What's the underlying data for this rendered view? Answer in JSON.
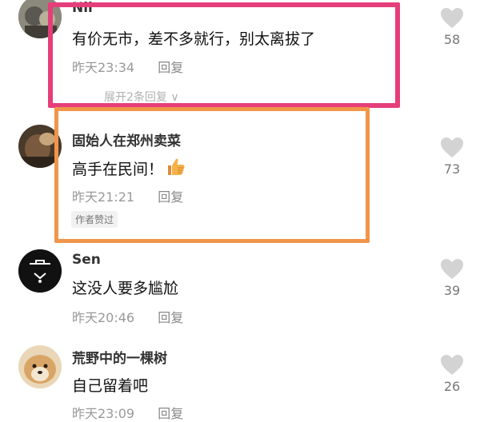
{
  "comments": [
    {
      "username": "Nil",
      "content": "有价无市，差不多就行，别太离拔了",
      "time": "昨天23:34",
      "reply": "回复",
      "likes": "58",
      "expand": "展开2条回复 ∨"
    },
    {
      "username": "固始人在郑州卖菜",
      "content": "高手在民间！",
      "emoji": "thumbs-up-emoji",
      "time": "昨天21:21",
      "reply": "回复",
      "likes": "73",
      "badge": "作者赞过"
    },
    {
      "username": "Sen",
      "content": "这没人要多尴尬",
      "time": "昨天20:46",
      "reply": "回复",
      "likes": "39"
    },
    {
      "username": "荒野中的一棵树",
      "content": "自己留着吧",
      "time": "昨天23:09",
      "reply": "回复",
      "likes": "26"
    }
  ],
  "colors": {
    "highlight_pink": "#e63e7a",
    "highlight_orange": "#f0954a",
    "heart": "#d3d3d3"
  },
  "icons": [
    "heart-icon",
    "thumbs-up-emoji",
    "chevron-down-icon"
  ]
}
